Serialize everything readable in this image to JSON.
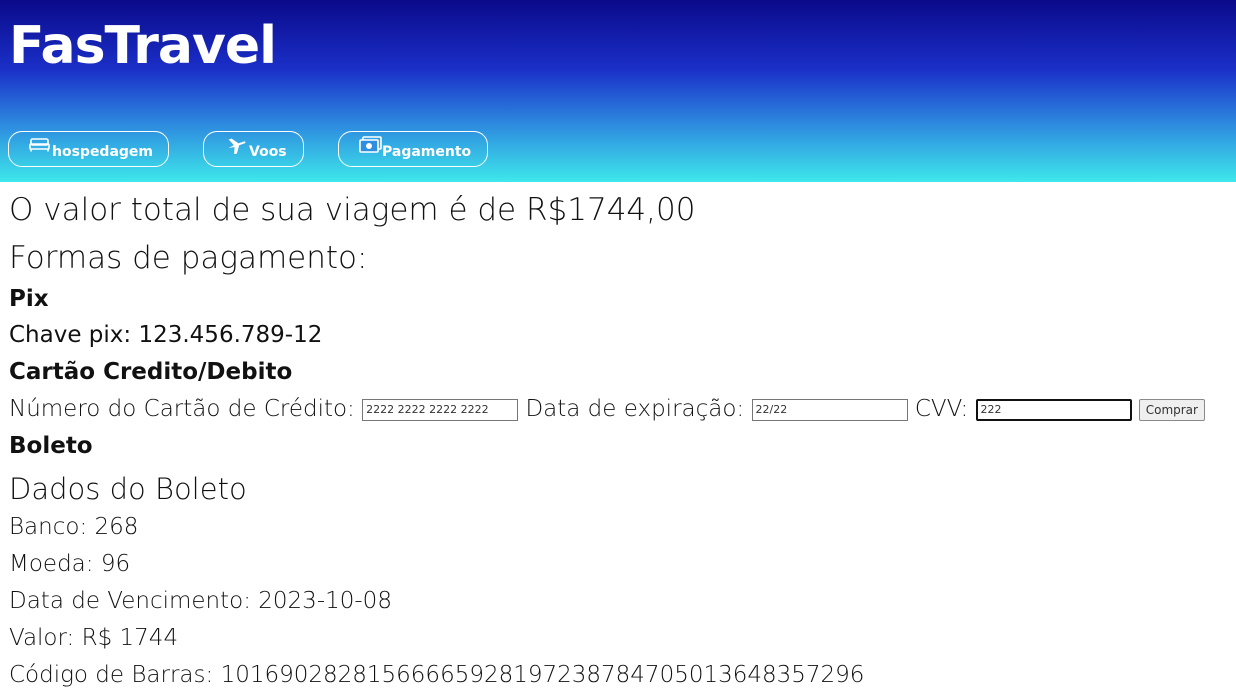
{
  "header": {
    "brand": "FasTravel",
    "nav": [
      {
        "label": "hospedagem",
        "icon": "bed-icon"
      },
      {
        "label": "Voos",
        "icon": "airplane-icon"
      },
      {
        "label": "Pagamento",
        "icon": "money-icon"
      }
    ]
  },
  "main": {
    "total_text": "O valor total de sua viagem é de R$1744,00",
    "payment_heading": "Formas de pagamento:",
    "pix": {
      "title": "Pix",
      "key_text": "Chave pix: 123.456.789-12"
    },
    "card": {
      "title": "Cartão Credito/Debito",
      "number_label": "Número do Cartão de Crédito:",
      "number_value": "2222 2222 2222 2222",
      "expiry_label": "Data de expiração:",
      "expiry_value": "22/22",
      "cvv_label": "CVV:",
      "cvv_value": "222",
      "buy_label": "Comprar"
    },
    "boleto": {
      "title": "Boleto",
      "subtitle": "Dados do Boleto",
      "banco": "Banco: 268",
      "moeda": "Moeda: 96",
      "vencimento": "Data de Vencimento: 2023-10-08",
      "valor": "Valor: R$ 1744",
      "codigo": "Código de Barras: 10169028281566665928197238784705013648357296"
    }
  },
  "colors": {
    "header_top": "#0b0a8a",
    "header_bottom": "#3ee8ea",
    "text": "#111111"
  }
}
